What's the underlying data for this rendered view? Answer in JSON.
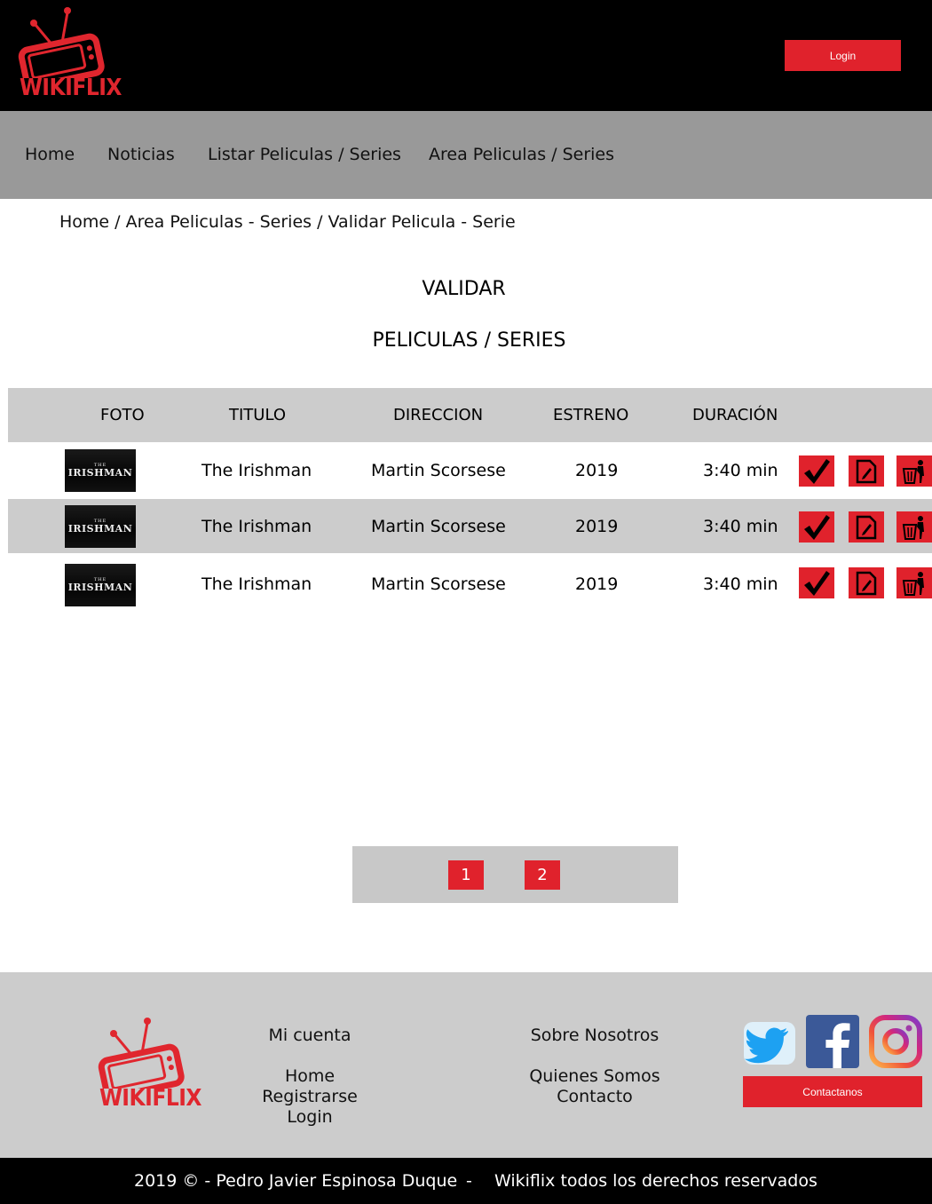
{
  "header": {
    "brand": "WIKIFLIX",
    "login_label": "Login"
  },
  "nav": {
    "items": [
      "Home",
      "Noticias",
      "Listar Peliculas / Series",
      "Area Peliculas / Series"
    ]
  },
  "breadcrumb": "Home / Area Peliculas - Series / Validar Pelicula - Serie",
  "page": {
    "title_line1": "VALIDAR",
    "title_line2": "PELICULAS / SERIES"
  },
  "table": {
    "columns": [
      "FOTO",
      "TITULO",
      "DIRECCION",
      "ESTRENO",
      "DURACIÓN"
    ],
    "poster_text_small": "THE",
    "poster_text_big": "IRISHMAN",
    "rows": [
      {
        "titulo": "The Irishman",
        "direccion": "Martin Scorsese",
        "estreno": "2019",
        "duracion": "3:40 min"
      },
      {
        "titulo": "The Irishman",
        "direccion": "Martin Scorsese",
        "estreno": "2019",
        "duracion": "3:40 min"
      },
      {
        "titulo": "The Irishman",
        "direccion": "Martin Scorsese",
        "estreno": "2019",
        "duracion": "3:40 min"
      }
    ],
    "actions": [
      "check-icon",
      "edit-icon",
      "trash-icon"
    ]
  },
  "pagination": {
    "pages": [
      "1",
      "2"
    ]
  },
  "footer": {
    "brand": "WIKIFLIX",
    "col1_title": "Mi cuenta",
    "col1_links": [
      "Home",
      "Registrarse",
      "Login"
    ],
    "col2_title": "Sobre Nosotros",
    "col2_links": [
      "Quienes Somos",
      "Contacto"
    ],
    "social": [
      "twitter-icon",
      "facebook-icon",
      "instagram-icon"
    ],
    "contact_label": "Contactanos",
    "copyright": "2019 © - Pedro Javier Espinosa Duque",
    "separator": "-",
    "rights": "Wikiflix todos los derechos reservados"
  },
  "colors": {
    "accent": "#e0222c",
    "header_bg": "#000000",
    "nav_bg": "#999999",
    "row_alt": "#cccccc"
  }
}
